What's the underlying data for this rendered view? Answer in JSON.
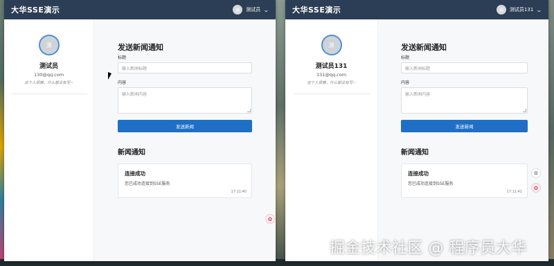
{
  "app": {
    "brand": "大华SSE演示"
  },
  "windows": [
    {
      "topbar": {
        "user_name": "测试员",
        "avatar_text": "测"
      },
      "profile": {
        "avatar_text": "测",
        "name": "测试员",
        "email": "130@qq.com",
        "signature": "这个人很懒，什么都没有写~"
      },
      "form": {
        "heading": "发送新闻通知",
        "title_label": "标题",
        "title_placeholder": "输入新闻标题",
        "content_label": "内容",
        "content_placeholder": "输入新闻内容",
        "submit_label": "发送新闻"
      },
      "news": {
        "heading": "新闻通知",
        "items": [
          {
            "title": "连接成功",
            "body": "您已成功连接到SSE服务",
            "time": "17:11:40"
          }
        ]
      }
    },
    {
      "topbar": {
        "user_name": "测试员131",
        "avatar_text": "测"
      },
      "profile": {
        "avatar_text": "测",
        "name": "测试员131",
        "email": "131@qq.com",
        "signature": "这个人很懒，什么都没有写~"
      },
      "form": {
        "heading": "发送新闻通知",
        "title_label": "标题",
        "title_placeholder": "输入新闻标题",
        "content_label": "内容",
        "content_placeholder": "输入新闻内容",
        "submit_label": "发送新闻"
      },
      "news": {
        "heading": "新闻通知",
        "items": [
          {
            "title": "连接成功",
            "body": "您已成功连接到SSE服务",
            "time": "17:11:41"
          }
        ]
      }
    }
  ],
  "overlay": {
    "watermark": "掘金技术社区 @ 程序员大华"
  },
  "icons": {
    "user_menu_chevron": "chevron-down-icon",
    "float_button": "assistant-icon",
    "grid_button": "apps-grid-icon"
  },
  "colors": {
    "topbar": "#2c3e55",
    "primary_button": "#1f6fc6",
    "avatar_ring": "#4a90d9"
  }
}
